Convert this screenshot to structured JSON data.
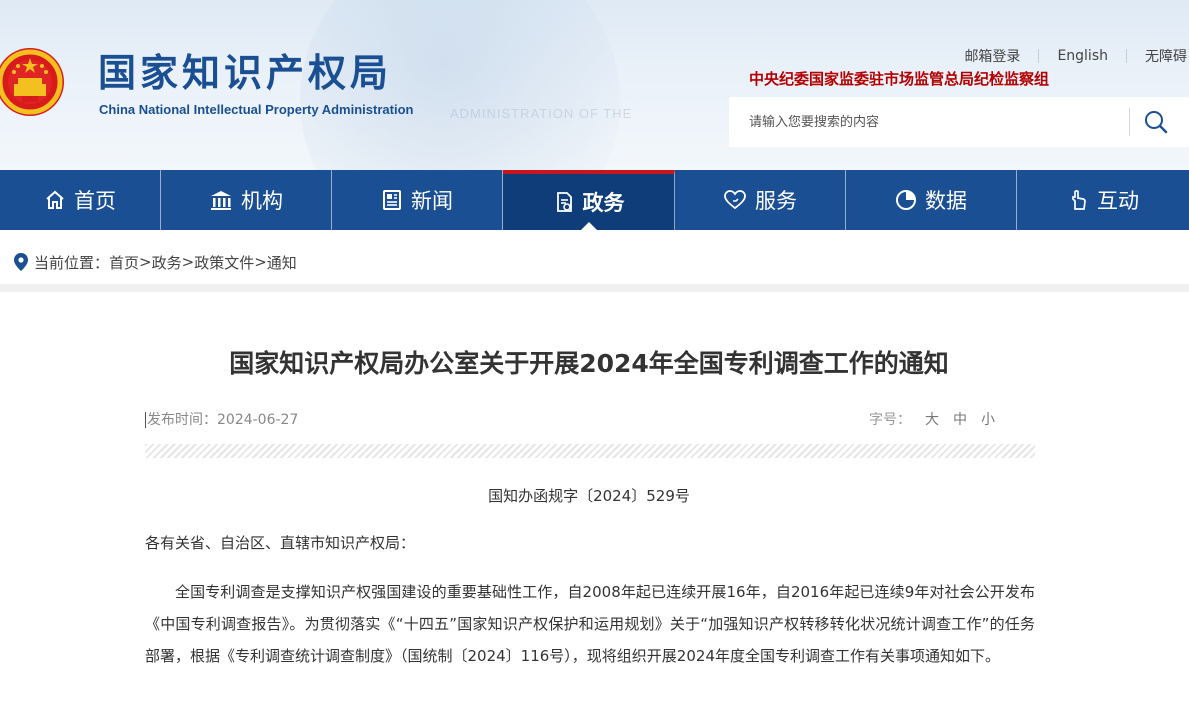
{
  "header": {
    "site_title": "国家知识产权局",
    "site_subtitle": "China National Intellectual Property Administration",
    "watermark": "ADMINISTRATION OF THE",
    "top_links": [
      "邮箱登录",
      "English",
      "无障碍"
    ],
    "discipline_link": "中央纪委国家监委驻市场监管总局纪检监察组",
    "search_placeholder": "请输入您要搜索的内容"
  },
  "nav": {
    "items": [
      {
        "label": "首页",
        "icon": "home-icon"
      },
      {
        "label": "机构",
        "icon": "institution-icon"
      },
      {
        "label": "新闻",
        "icon": "news-icon"
      },
      {
        "label": "政务",
        "icon": "document-icon"
      },
      {
        "label": "服务",
        "icon": "heart-hand-icon"
      },
      {
        "label": "数据",
        "icon": "pie-chart-icon"
      },
      {
        "label": "互动",
        "icon": "hand-pointer-icon"
      }
    ],
    "active": "政务"
  },
  "breadcrumb": {
    "prefix": "当前位置：",
    "items": [
      "首页",
      "政务",
      "政策文件",
      "通知"
    ],
    "separator": ">"
  },
  "article": {
    "title": "国家知识产权局办公室关于开展2024年全国专利调查工作的通知",
    "publish_label": "发布时间：",
    "publish_date": "2024-06-27",
    "font_label": "字号：",
    "font_sizes": [
      "大",
      "中",
      "小"
    ],
    "doc_number": "国知办函规字〔2024〕529号",
    "salutation": "各有关省、自治区、直辖市知识产权局：",
    "paragraph": "全国专利调查是支撑知识产权强国建设的重要基础性工作，自2008年起已连续开展16年，自2016年起已连续9年对社会公开发布《中国专利调查报告》。为贯彻落实《“十四五”国家知识产权保护和运用规划》关于“加强知识产权转移转化状况统计调查工作”的任务部署，根据《专利调查统计调查制度》（国统制〔2024〕116号），现将组织开展2024年度全国专利调查工作有关事项通知如下。"
  },
  "colors": {
    "brand_blue": "#1b4f93",
    "nav_active": "#0f3d7a",
    "accent_red": "#c8161d",
    "discipline_red": "#b30000"
  }
}
